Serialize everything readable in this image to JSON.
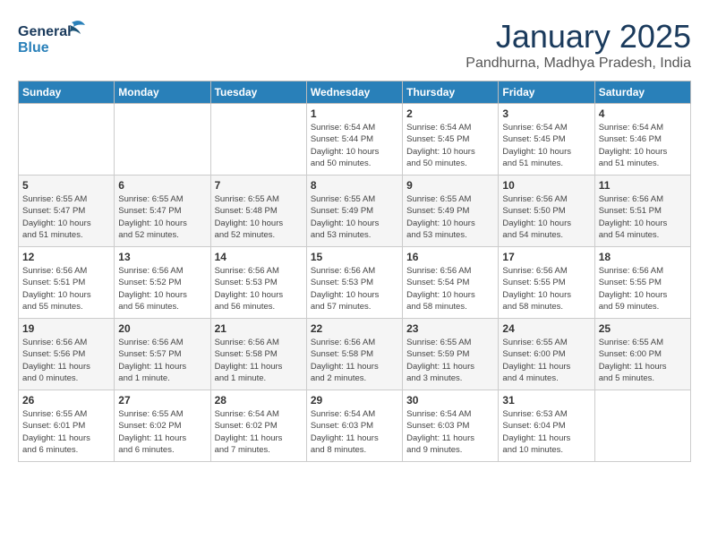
{
  "header": {
    "logo_general": "General",
    "logo_blue": "Blue",
    "month_title": "January 2025",
    "subtitle": "Pandhurna, Madhya Pradesh, India"
  },
  "days_of_week": [
    "Sunday",
    "Monday",
    "Tuesday",
    "Wednesday",
    "Thursday",
    "Friday",
    "Saturday"
  ],
  "weeks": [
    [
      {
        "day": "",
        "content": ""
      },
      {
        "day": "",
        "content": ""
      },
      {
        "day": "",
        "content": ""
      },
      {
        "day": "1",
        "content": "Sunrise: 6:54 AM\nSunset: 5:44 PM\nDaylight: 10 hours\nand 50 minutes."
      },
      {
        "day": "2",
        "content": "Sunrise: 6:54 AM\nSunset: 5:45 PM\nDaylight: 10 hours\nand 50 minutes."
      },
      {
        "day": "3",
        "content": "Sunrise: 6:54 AM\nSunset: 5:45 PM\nDaylight: 10 hours\nand 51 minutes."
      },
      {
        "day": "4",
        "content": "Sunrise: 6:54 AM\nSunset: 5:46 PM\nDaylight: 10 hours\nand 51 minutes."
      }
    ],
    [
      {
        "day": "5",
        "content": "Sunrise: 6:55 AM\nSunset: 5:47 PM\nDaylight: 10 hours\nand 51 minutes."
      },
      {
        "day": "6",
        "content": "Sunrise: 6:55 AM\nSunset: 5:47 PM\nDaylight: 10 hours\nand 52 minutes."
      },
      {
        "day": "7",
        "content": "Sunrise: 6:55 AM\nSunset: 5:48 PM\nDaylight: 10 hours\nand 52 minutes."
      },
      {
        "day": "8",
        "content": "Sunrise: 6:55 AM\nSunset: 5:49 PM\nDaylight: 10 hours\nand 53 minutes."
      },
      {
        "day": "9",
        "content": "Sunrise: 6:55 AM\nSunset: 5:49 PM\nDaylight: 10 hours\nand 53 minutes."
      },
      {
        "day": "10",
        "content": "Sunrise: 6:56 AM\nSunset: 5:50 PM\nDaylight: 10 hours\nand 54 minutes."
      },
      {
        "day": "11",
        "content": "Sunrise: 6:56 AM\nSunset: 5:51 PM\nDaylight: 10 hours\nand 54 minutes."
      }
    ],
    [
      {
        "day": "12",
        "content": "Sunrise: 6:56 AM\nSunset: 5:51 PM\nDaylight: 10 hours\nand 55 minutes."
      },
      {
        "day": "13",
        "content": "Sunrise: 6:56 AM\nSunset: 5:52 PM\nDaylight: 10 hours\nand 56 minutes."
      },
      {
        "day": "14",
        "content": "Sunrise: 6:56 AM\nSunset: 5:53 PM\nDaylight: 10 hours\nand 56 minutes."
      },
      {
        "day": "15",
        "content": "Sunrise: 6:56 AM\nSunset: 5:53 PM\nDaylight: 10 hours\nand 57 minutes."
      },
      {
        "day": "16",
        "content": "Sunrise: 6:56 AM\nSunset: 5:54 PM\nDaylight: 10 hours\nand 58 minutes."
      },
      {
        "day": "17",
        "content": "Sunrise: 6:56 AM\nSunset: 5:55 PM\nDaylight: 10 hours\nand 58 minutes."
      },
      {
        "day": "18",
        "content": "Sunrise: 6:56 AM\nSunset: 5:55 PM\nDaylight: 10 hours\nand 59 minutes."
      }
    ],
    [
      {
        "day": "19",
        "content": "Sunrise: 6:56 AM\nSunset: 5:56 PM\nDaylight: 11 hours\nand 0 minutes."
      },
      {
        "day": "20",
        "content": "Sunrise: 6:56 AM\nSunset: 5:57 PM\nDaylight: 11 hours\nand 1 minute."
      },
      {
        "day": "21",
        "content": "Sunrise: 6:56 AM\nSunset: 5:58 PM\nDaylight: 11 hours\nand 1 minute."
      },
      {
        "day": "22",
        "content": "Sunrise: 6:56 AM\nSunset: 5:58 PM\nDaylight: 11 hours\nand 2 minutes."
      },
      {
        "day": "23",
        "content": "Sunrise: 6:55 AM\nSunset: 5:59 PM\nDaylight: 11 hours\nand 3 minutes."
      },
      {
        "day": "24",
        "content": "Sunrise: 6:55 AM\nSunset: 6:00 PM\nDaylight: 11 hours\nand 4 minutes."
      },
      {
        "day": "25",
        "content": "Sunrise: 6:55 AM\nSunset: 6:00 PM\nDaylight: 11 hours\nand 5 minutes."
      }
    ],
    [
      {
        "day": "26",
        "content": "Sunrise: 6:55 AM\nSunset: 6:01 PM\nDaylight: 11 hours\nand 6 minutes."
      },
      {
        "day": "27",
        "content": "Sunrise: 6:55 AM\nSunset: 6:02 PM\nDaylight: 11 hours\nand 6 minutes."
      },
      {
        "day": "28",
        "content": "Sunrise: 6:54 AM\nSunset: 6:02 PM\nDaylight: 11 hours\nand 7 minutes."
      },
      {
        "day": "29",
        "content": "Sunrise: 6:54 AM\nSunset: 6:03 PM\nDaylight: 11 hours\nand 8 minutes."
      },
      {
        "day": "30",
        "content": "Sunrise: 6:54 AM\nSunset: 6:03 PM\nDaylight: 11 hours\nand 9 minutes."
      },
      {
        "day": "31",
        "content": "Sunrise: 6:53 AM\nSunset: 6:04 PM\nDaylight: 11 hours\nand 10 minutes."
      },
      {
        "day": "",
        "content": ""
      }
    ]
  ]
}
